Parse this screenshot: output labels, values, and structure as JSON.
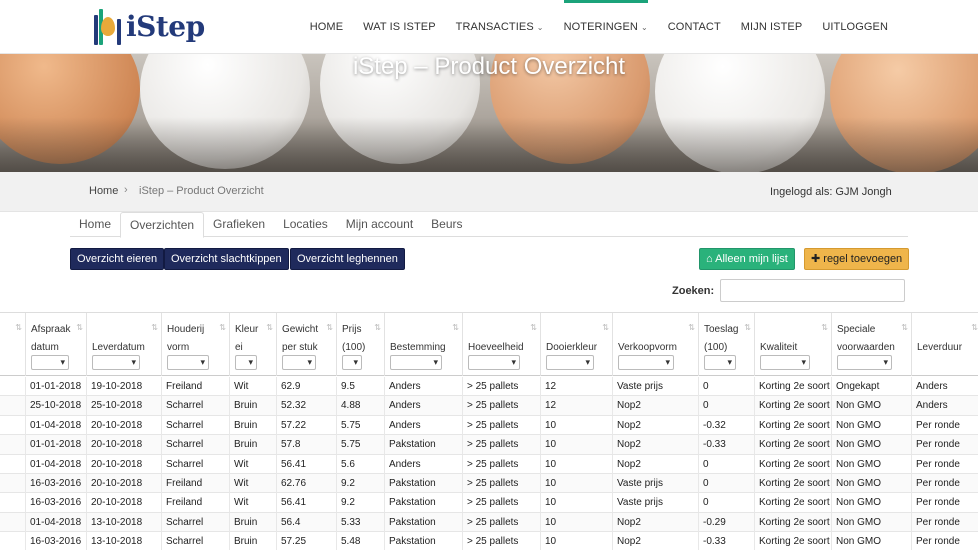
{
  "header": {
    "logo_text": "iStep",
    "nav": [
      {
        "label": "HOME",
        "caret": false,
        "active": false
      },
      {
        "label": "WAT IS ISTEP",
        "caret": false,
        "active": false
      },
      {
        "label": "TRANSACTIES",
        "caret": true,
        "active": false
      },
      {
        "label": "NOTERINGEN",
        "caret": true,
        "active": true
      },
      {
        "label": "CONTACT",
        "caret": false,
        "active": false
      },
      {
        "label": "MIJN ISTEP",
        "caret": false,
        "active": false
      },
      {
        "label": "UITLOGGEN",
        "caret": false,
        "active": false
      }
    ]
  },
  "hero": {
    "title": "iStep – Product Overzicht"
  },
  "breadcrumb": {
    "home": "Home",
    "separator": "›",
    "current": "iStep – Product Overzicht",
    "logged_in": "Ingelogd als: GJM Jongh"
  },
  "tabs": [
    {
      "label": "Home",
      "active": false
    },
    {
      "label": "Overzichten",
      "active": true
    },
    {
      "label": "Grafieken",
      "active": false
    },
    {
      "label": "Locaties",
      "active": false
    },
    {
      "label": "Mijn account",
      "active": false
    },
    {
      "label": "Beurs",
      "active": false
    }
  ],
  "buttons": {
    "eieren": "Overzicht eieren",
    "slachtkippen": "Overzicht slachtkippen",
    "leghennen": "Overzicht leghennen",
    "alleen": "Alleen mijn lijst",
    "toevoegen": "regel toevoegen"
  },
  "search": {
    "label": "Zoeken:",
    "value": ""
  },
  "table": {
    "columns": [
      {
        "label": "",
        "sub": "",
        "filter": false
      },
      {
        "label": "Afspraak",
        "sub": "datum",
        "filter": true
      },
      {
        "label": "",
        "sub": "Leverdatum",
        "filter": true
      },
      {
        "label": "Houderij",
        "sub": "vorm",
        "filter": true
      },
      {
        "label": "Kleur",
        "sub": "ei",
        "filter": true
      },
      {
        "label": "Gewicht",
        "sub": "per stuk",
        "filter": true
      },
      {
        "label": "Prijs",
        "sub": "(100)",
        "filter": true
      },
      {
        "label": "",
        "sub": "Bestemming",
        "filter": true
      },
      {
        "label": "",
        "sub": "Hoeveelheid",
        "filter": true
      },
      {
        "label": "",
        "sub": "Dooierkleur",
        "filter": true
      },
      {
        "label": "",
        "sub": "Verkoopvorm",
        "filter": true
      },
      {
        "label": "Toeslag",
        "sub": "(100)",
        "filter": true
      },
      {
        "label": "",
        "sub": "Kwaliteit",
        "filter": true
      },
      {
        "label": "Speciale",
        "sub": "voorwaarden",
        "filter": true
      },
      {
        "label": "",
        "sub": "Leverduur",
        "filter": false
      }
    ],
    "rows": [
      [
        "",
        "01-01-2018",
        "19-10-2018",
        "Freiland",
        "Wit",
        "62.9",
        "9.5",
        "Anders",
        "> 25 pallets",
        "12",
        "Vaste prijs",
        "0",
        "Korting 2e soort",
        "Ongekapt",
        "Anders"
      ],
      [
        "",
        "25-10-2018",
        "25-10-2018",
        "Scharrel",
        "Bruin",
        "52.32",
        "4.88",
        "Anders",
        "> 25 pallets",
        "12",
        "Nop2",
        "0",
        "Korting 2e soort",
        "Non GMO",
        "Anders"
      ],
      [
        "",
        "01-04-2018",
        "20-10-2018",
        "Scharrel",
        "Bruin",
        "57.22",
        "5.75",
        "Anders",
        "> 25 pallets",
        "10",
        "Nop2",
        "-0.32",
        "Korting 2e soort",
        "Non GMO",
        "Per ronde"
      ],
      [
        "",
        "01-01-2018",
        "20-10-2018",
        "Scharrel",
        "Bruin",
        "57.8",
        "5.75",
        "Pakstation",
        "> 25 pallets",
        "10",
        "Nop2",
        "-0.33",
        "Korting 2e soort",
        "Non GMO",
        "Per ronde"
      ],
      [
        "",
        "01-04-2018",
        "20-10-2018",
        "Scharrel",
        "Wit",
        "56.41",
        "5.6",
        "Anders",
        "> 25 pallets",
        "10",
        "Nop2",
        "0",
        "Korting 2e soort",
        "Non GMO",
        "Per ronde"
      ],
      [
        "",
        "16-03-2016",
        "20-10-2018",
        "Freiland",
        "Wit",
        "62.76",
        "9.2",
        "Pakstation",
        "> 25 pallets",
        "10",
        "Vaste prijs",
        "0",
        "Korting 2e soort",
        "Non GMO",
        "Per ronde"
      ],
      [
        "",
        "16-03-2016",
        "20-10-2018",
        "Freiland",
        "Wit",
        "56.41",
        "9.2",
        "Pakstation",
        "> 25 pallets",
        "10",
        "Vaste prijs",
        "0",
        "Korting 2e soort",
        "Non GMO",
        "Per ronde"
      ],
      [
        "",
        "01-04-2018",
        "13-10-2018",
        "Scharrel",
        "Bruin",
        "56.4",
        "5.33",
        "Pakstation",
        "> 25 pallets",
        "10",
        "Nop2",
        "-0.29",
        "Korting 2e soort",
        "Non GMO",
        "Per ronde"
      ],
      [
        "",
        "16-03-2016",
        "13-10-2018",
        "Scharrel",
        "Bruin",
        "57.25",
        "5.48",
        "Pakstation",
        "> 25 pallets",
        "10",
        "Nop2",
        "-0.33",
        "Korting 2e soort",
        "Non GMO",
        "Per ronde"
      ]
    ]
  },
  "colors": {
    "brand_navy": "#233a7a",
    "accent_green": "#1ba37a",
    "btn_dark": "#1f2a5c",
    "btn_green": "#2ab27b",
    "btn_orange": "#efb54b"
  }
}
